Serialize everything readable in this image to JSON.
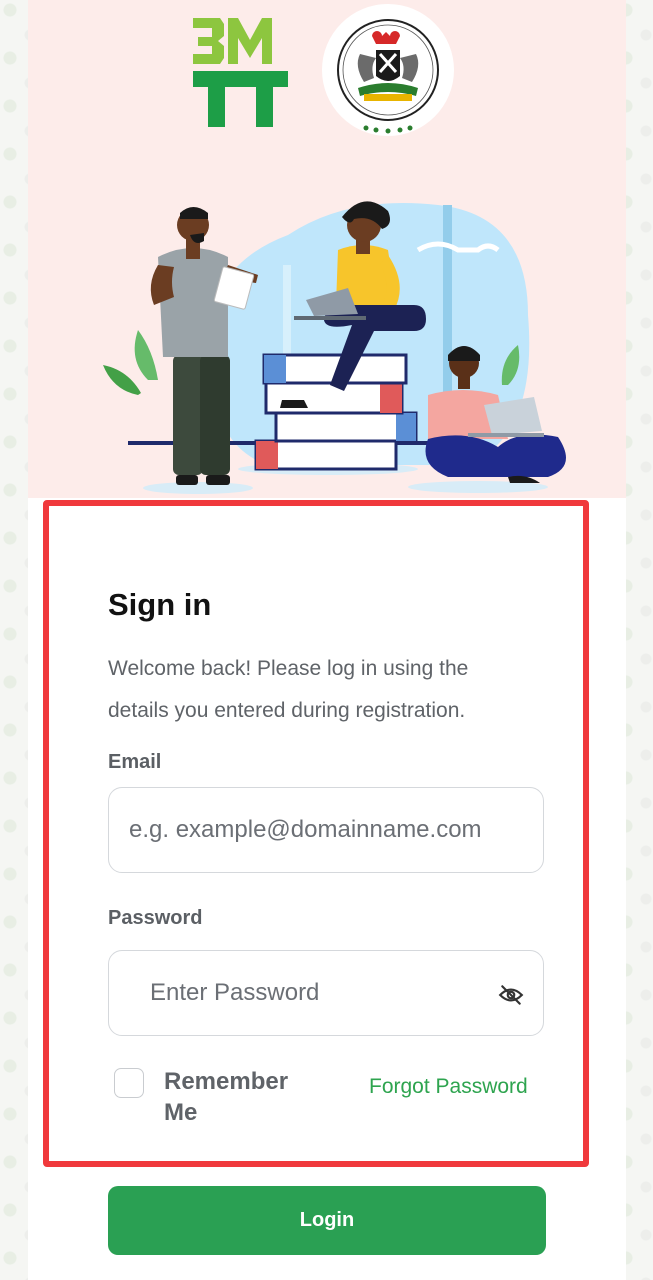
{
  "brand": {
    "logo_text": "3MTT",
    "seal_text": "FEDERAL MINISTRY OF COMMUNICATIONS, INNOVATION & DIGITAL ECONOMY"
  },
  "form": {
    "title": "Sign in",
    "subtitle": "Welcome back! Please log in using the details you entered during registration.",
    "email_label": "Email",
    "email_placeholder": "e.g. example@domainname.com",
    "password_label": "Password",
    "password_placeholder": "Enter Password",
    "remember_label": "Remember Me",
    "remember_checked": false,
    "forgot_label": "Forgot Password",
    "login_label": "Login"
  },
  "icons": {
    "password_toggle": "eye-off-icon"
  },
  "colors": {
    "accent_green": "#2aa053",
    "highlight_red": "#f0393c",
    "hero_background": "#fdecea"
  }
}
